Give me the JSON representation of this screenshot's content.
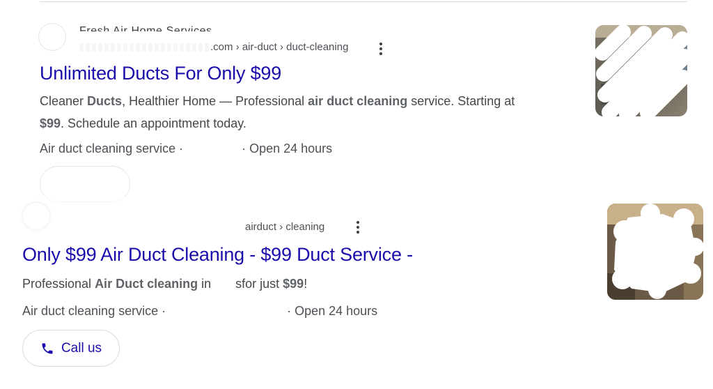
{
  "results": [
    {
      "site_name": "Fresh Air Home Services",
      "url_tail": ".com › air-duct › duct-cleaning",
      "title": "Unlimited Ducts For Only $99",
      "desc_parts": [
        "Cleaner ",
        "Ducts",
        ", Healthier Home — Professional ",
        "air duct cleaning",
        " service. Starting at ",
        "$99",
        ". Schedule an appointment today."
      ],
      "meta_left": "Air duct cleaning service · ",
      "meta_right": " · Open 24 hours"
    },
    {
      "url_tail": "airduct › cleaning",
      "title": "Only $99 Air Duct Cleaning - $99 Duct Service -",
      "desc_parts": [
        "Professional ",
        "Air Duct cleaning",
        " in ",
        "sfor just ",
        "$99",
        "!"
      ],
      "meta_left": "Air duct cleaning service · ",
      "meta_right": " · Open 24 hours",
      "action_label": "Call us"
    }
  ],
  "icons": {
    "more": "more-vert-icon",
    "phone": "phone-icon"
  },
  "colors": {
    "link": "#1a0dab",
    "text": "#474747",
    "divider": "#dadce0"
  }
}
